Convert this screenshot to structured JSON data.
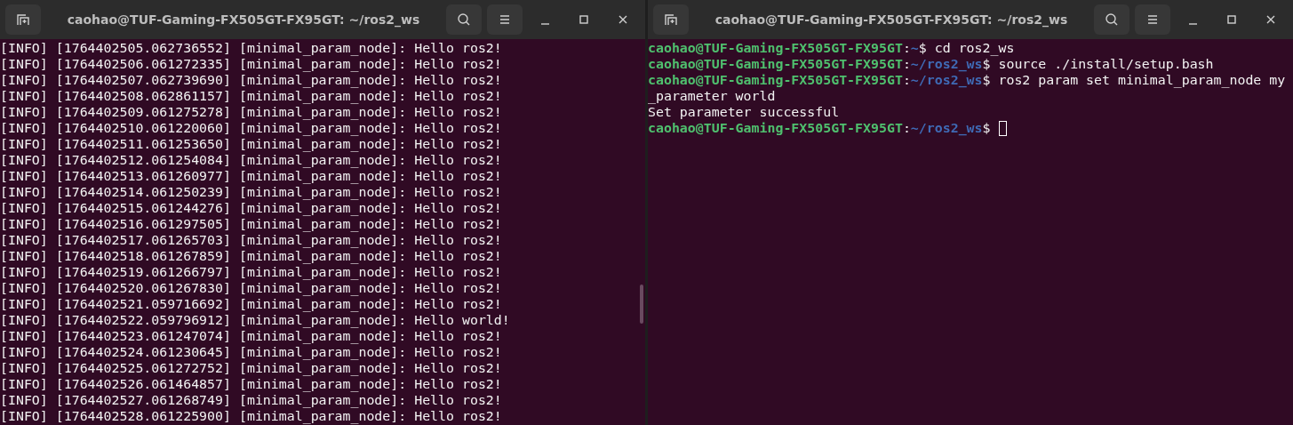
{
  "windows": [
    {
      "title": "caohao@TUF-Gaming-FX505GT-FX95GT: ~/ros2_ws",
      "scrollbar": true,
      "lines": [
        {
          "segments": [
            {
              "kind": "plain",
              "text": "[INFO] [1764402505.062736552] [minimal_param_node]: Hello ros2!"
            }
          ]
        },
        {
          "segments": [
            {
              "kind": "plain",
              "text": "[INFO] [1764402506.061272335] [minimal_param_node]: Hello ros2!"
            }
          ]
        },
        {
          "segments": [
            {
              "kind": "plain",
              "text": "[INFO] [1764402507.062739690] [minimal_param_node]: Hello ros2!"
            }
          ]
        },
        {
          "segments": [
            {
              "kind": "plain",
              "text": "[INFO] [1764402508.062861157] [minimal_param_node]: Hello ros2!"
            }
          ]
        },
        {
          "segments": [
            {
              "kind": "plain",
              "text": "[INFO] [1764402509.061275278] [minimal_param_node]: Hello ros2!"
            }
          ]
        },
        {
          "segments": [
            {
              "kind": "plain",
              "text": "[INFO] [1764402510.061220060] [minimal_param_node]: Hello ros2!"
            }
          ]
        },
        {
          "segments": [
            {
              "kind": "plain",
              "text": "[INFO] [1764402511.061253650] [minimal_param_node]: Hello ros2!"
            }
          ]
        },
        {
          "segments": [
            {
              "kind": "plain",
              "text": "[INFO] [1764402512.061254084] [minimal_param_node]: Hello ros2!"
            }
          ]
        },
        {
          "segments": [
            {
              "kind": "plain",
              "text": "[INFO] [1764402513.061260977] [minimal_param_node]: Hello ros2!"
            }
          ]
        },
        {
          "segments": [
            {
              "kind": "plain",
              "text": "[INFO] [1764402514.061250239] [minimal_param_node]: Hello ros2!"
            }
          ]
        },
        {
          "segments": [
            {
              "kind": "plain",
              "text": "[INFO] [1764402515.061244276] [minimal_param_node]: Hello ros2!"
            }
          ]
        },
        {
          "segments": [
            {
              "kind": "plain",
              "text": "[INFO] [1764402516.061297505] [minimal_param_node]: Hello ros2!"
            }
          ]
        },
        {
          "segments": [
            {
              "kind": "plain",
              "text": "[INFO] [1764402517.061265703] [minimal_param_node]: Hello ros2!"
            }
          ]
        },
        {
          "segments": [
            {
              "kind": "plain",
              "text": "[INFO] [1764402518.061267859] [minimal_param_node]: Hello ros2!"
            }
          ]
        },
        {
          "segments": [
            {
              "kind": "plain",
              "text": "[INFO] [1764402519.061266797] [minimal_param_node]: Hello ros2!"
            }
          ]
        },
        {
          "segments": [
            {
              "kind": "plain",
              "text": "[INFO] [1764402520.061267830] [minimal_param_node]: Hello ros2!"
            }
          ]
        },
        {
          "segments": [
            {
              "kind": "plain",
              "text": "[INFO] [1764402521.059716692] [minimal_param_node]: Hello ros2!"
            }
          ]
        },
        {
          "segments": [
            {
              "kind": "plain",
              "text": "[INFO] [1764402522.059796912] [minimal_param_node]: Hello world!"
            }
          ]
        },
        {
          "segments": [
            {
              "kind": "plain",
              "text": "[INFO] [1764402523.061247074] [minimal_param_node]: Hello ros2!"
            }
          ]
        },
        {
          "segments": [
            {
              "kind": "plain",
              "text": "[INFO] [1764402524.061230645] [minimal_param_node]: Hello ros2!"
            }
          ]
        },
        {
          "segments": [
            {
              "kind": "plain",
              "text": "[INFO] [1764402525.061272752] [minimal_param_node]: Hello ros2!"
            }
          ]
        },
        {
          "segments": [
            {
              "kind": "plain",
              "text": "[INFO] [1764402526.061464857] [minimal_param_node]: Hello ros2!"
            }
          ]
        },
        {
          "segments": [
            {
              "kind": "plain",
              "text": "[INFO] [1764402527.061268749] [minimal_param_node]: Hello ros2!"
            }
          ]
        },
        {
          "segments": [
            {
              "kind": "plain",
              "text": "[INFO] [1764402528.061225900] [minimal_param_node]: Hello ros2!"
            }
          ]
        }
      ]
    },
    {
      "title": "caohao@TUF-Gaming-FX505GT-FX95GT: ~/ros2_ws",
      "scrollbar": false,
      "lines": [
        {
          "segments": [
            {
              "kind": "user",
              "text": "caohao@TUF-Gaming-FX505GT-FX95GT"
            },
            {
              "kind": "plain",
              "text": ":"
            },
            {
              "kind": "path",
              "text": "~"
            },
            {
              "kind": "plain",
              "text": "$ cd ros2_ws"
            }
          ]
        },
        {
          "segments": [
            {
              "kind": "user",
              "text": "caohao@TUF-Gaming-FX505GT-FX95GT"
            },
            {
              "kind": "plain",
              "text": ":"
            },
            {
              "kind": "path",
              "text": "~/ros2_ws"
            },
            {
              "kind": "plain",
              "text": "$ source ./install/setup.bash"
            }
          ]
        },
        {
          "segments": [
            {
              "kind": "user",
              "text": "caohao@TUF-Gaming-FX505GT-FX95GT"
            },
            {
              "kind": "plain",
              "text": ":"
            },
            {
              "kind": "path",
              "text": "~/ros2_ws"
            },
            {
              "kind": "plain",
              "text": "$ ros2 param set minimal_param_node my"
            }
          ]
        },
        {
          "segments": [
            {
              "kind": "plain",
              "text": "_parameter world"
            }
          ]
        },
        {
          "segments": [
            {
              "kind": "plain",
              "text": "Set parameter successful"
            }
          ]
        },
        {
          "cursor": true,
          "segments": [
            {
              "kind": "user",
              "text": "caohao@TUF-Gaming-FX505GT-FX95GT"
            },
            {
              "kind": "plain",
              "text": ":"
            },
            {
              "kind": "path",
              "text": "~/ros2_ws"
            },
            {
              "kind": "plain",
              "text": "$"
            }
          ]
        }
      ]
    }
  ]
}
